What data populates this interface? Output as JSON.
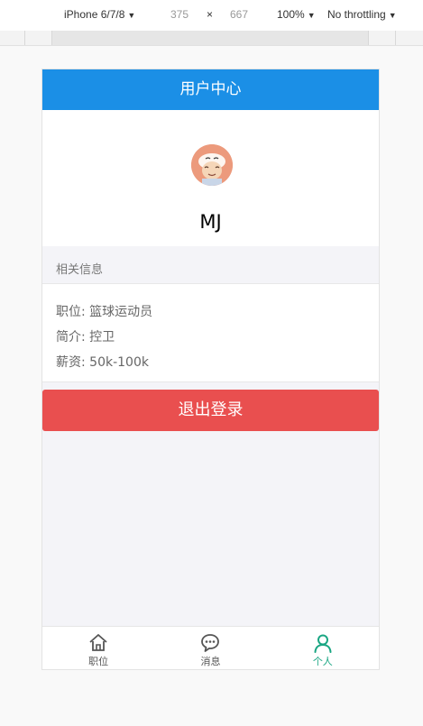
{
  "devtools": {
    "device": "iPhone 6/7/8",
    "width": "375",
    "times": "×",
    "height": "667",
    "zoom": "100%",
    "throttling": "No throttling"
  },
  "header": {
    "title": "用户中心"
  },
  "profile": {
    "username": "MJ"
  },
  "info": {
    "section_title": "相关信息",
    "position": "职位: 篮球运动员",
    "intro": "简介: 控卫",
    "salary": "薪资: 50k-100k"
  },
  "logout_label": "退出登录",
  "tabbar": {
    "items": [
      {
        "label": "职位",
        "icon": "home-icon",
        "active": false
      },
      {
        "label": "消息",
        "icon": "chat-icon",
        "active": false
      },
      {
        "label": "个人",
        "icon": "person-icon",
        "active": true
      }
    ],
    "active_color": "#1aa683"
  },
  "colors": {
    "header": "#1b8fe6",
    "logout": "#e94f4f"
  }
}
